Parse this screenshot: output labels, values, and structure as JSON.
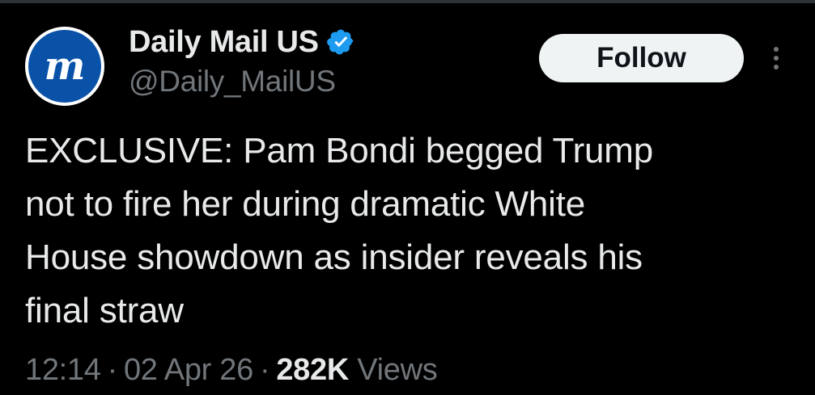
{
  "account": {
    "display_name": "Daily Mail US",
    "handle": "@Daily_MailUS",
    "verified": true,
    "verified_icon": "verified-badge-icon",
    "avatar_icon": "daily-mail-logo-icon",
    "avatar_color": "#0a52a8"
  },
  "actions": {
    "follow_label": "Follow",
    "more_icon": "more-options-icon"
  },
  "tweet": {
    "text_lines": [
      "EXCLUSIVE: Pam Bondi begged Trump",
      "not to fire her during dramatic White",
      "House showdown as insider reveals his",
      "final straw"
    ]
  },
  "meta": {
    "time": "12:14",
    "date": "02 Apr 26",
    "separator": "·",
    "views_count": "282K",
    "views_label": "Views"
  },
  "colors": {
    "background": "#000000",
    "text_primary": "#e7e9ea",
    "text_secondary": "#71767b",
    "verified_blue": "#1d9bf0",
    "follow_bg": "#eff3f4"
  }
}
